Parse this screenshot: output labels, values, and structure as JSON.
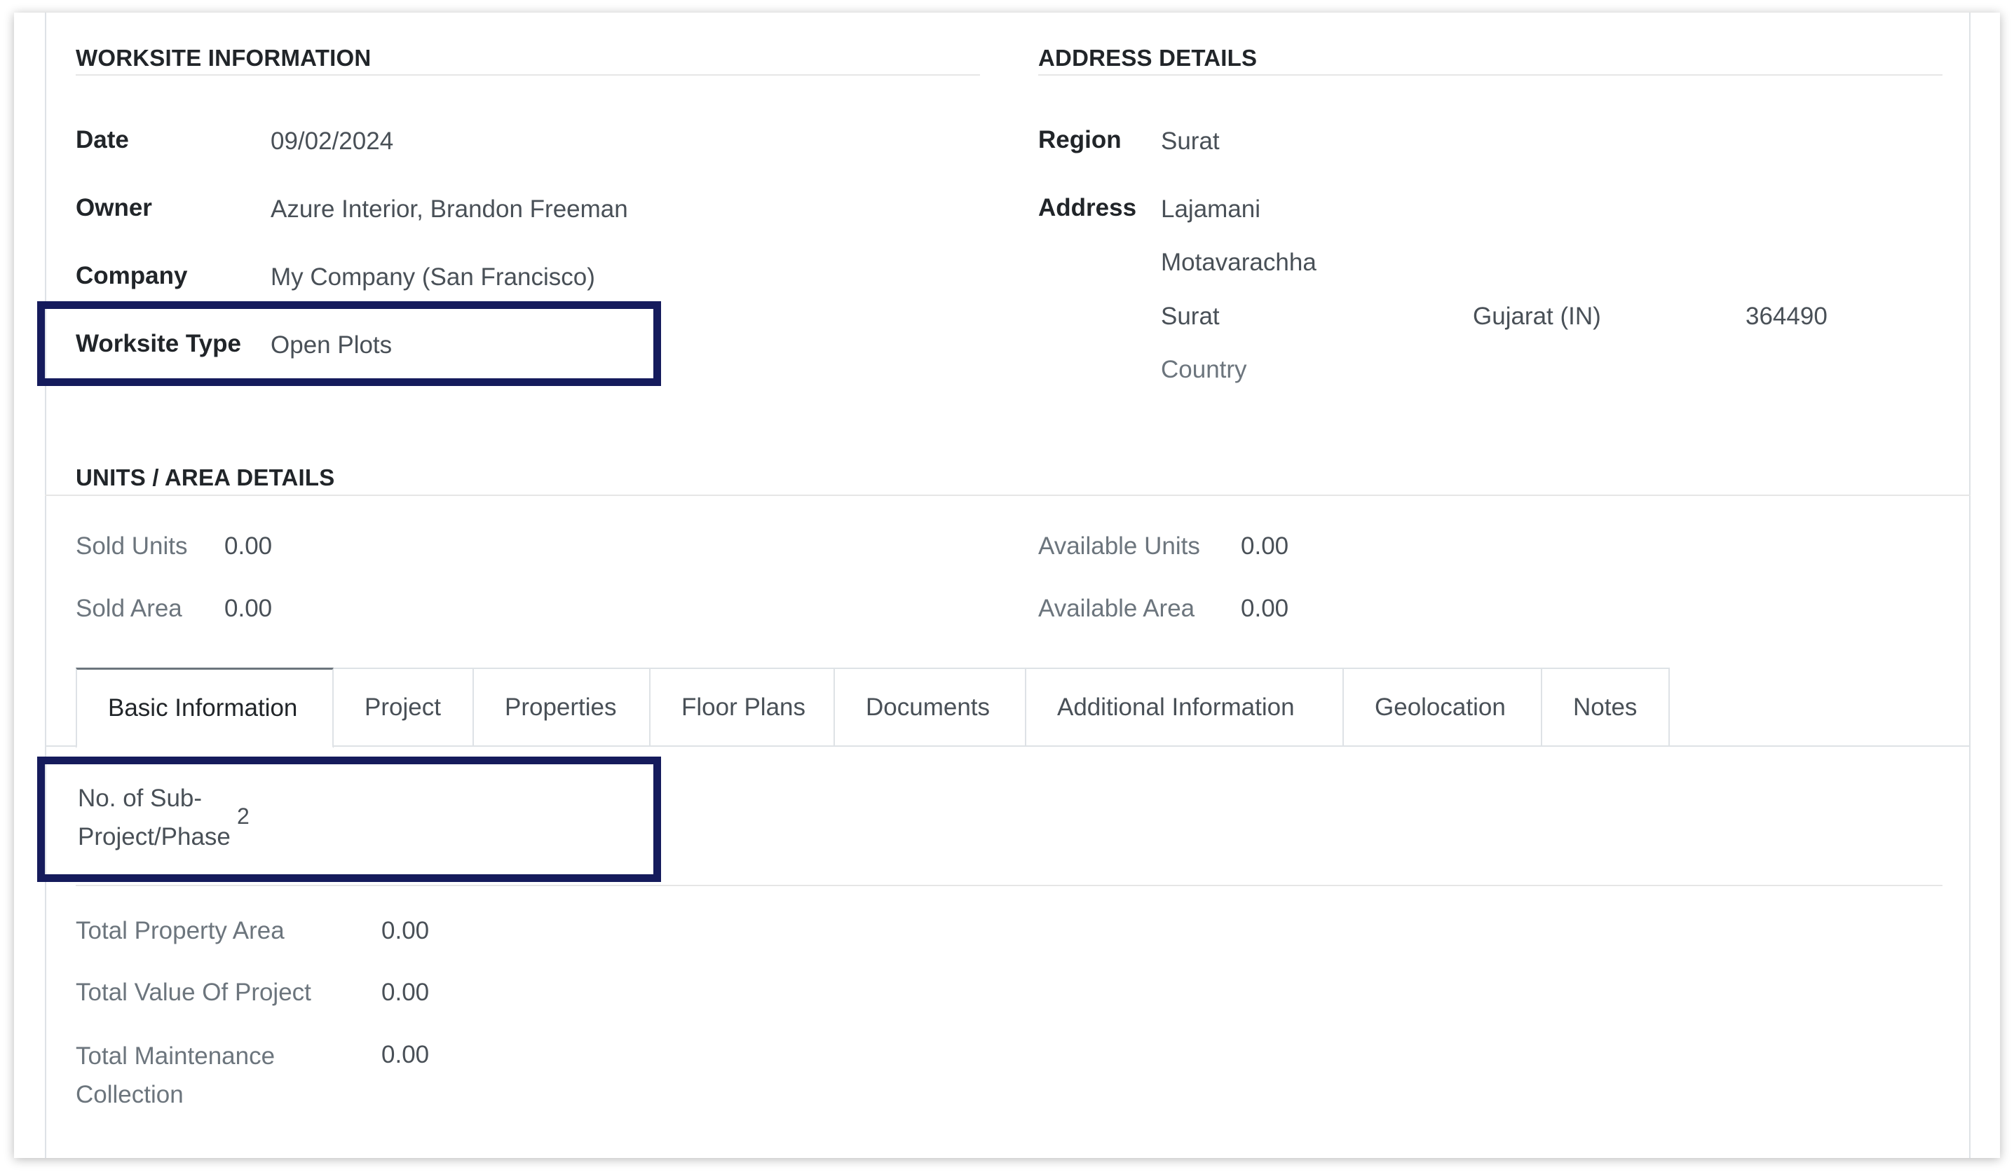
{
  "worksite": {
    "title": "WORKSITE INFORMATION",
    "fields": [
      {
        "label": "Date",
        "value": "09/02/2024"
      },
      {
        "label": "Owner",
        "value": "Azure Interior, Brandon Freeman"
      },
      {
        "label": "Company",
        "value": "My Company (San Francisco)"
      },
      {
        "label": "Worksite Type",
        "value": "Open Plots"
      }
    ]
  },
  "address": {
    "title": "ADDRESS DETAILS",
    "region_label": "Region",
    "region_value": "Surat",
    "address_label": "Address",
    "street": "Lajamani",
    "street2": "Motavarachha",
    "city": "Surat",
    "state": "Gujarat (IN)",
    "zip": "364490",
    "country_placeholder": "Country"
  },
  "units": {
    "title": "UNITS / AREA DETAILS",
    "sold_units_label": "Sold Units",
    "sold_units_value": "0.00",
    "sold_area_label": "Sold Area",
    "sold_area_value": "0.00",
    "available_units_label": "Available Units",
    "available_units_value": "0.00",
    "available_area_label": "Available Area",
    "available_area_value": "0.00"
  },
  "tabs": [
    {
      "label": "Basic Information",
      "active": true
    },
    {
      "label": "Project"
    },
    {
      "label": "Properties"
    },
    {
      "label": "Floor Plans"
    },
    {
      "label": "Documents"
    },
    {
      "label": "Additional Information"
    },
    {
      "label": "Geolocation"
    },
    {
      "label": "Notes"
    }
  ],
  "basic": {
    "subproject_label_line1": "No. of Sub-",
    "subproject_label_line2": "Project/Phase",
    "subproject_value": "2",
    "total_property_area_label": "Total Property Area",
    "total_property_area_value": "0.00",
    "total_value_label": "Total Value Of Project",
    "total_value_value": "0.00",
    "total_maintenance_label_line1": "Total Maintenance",
    "total_maintenance_label_line2": "Collection",
    "total_maintenance_value": "0.00"
  },
  "colors": {
    "highlight": "#151b5c",
    "label": "#212529",
    "muted_label": "#6c757d",
    "value": "#495057"
  }
}
